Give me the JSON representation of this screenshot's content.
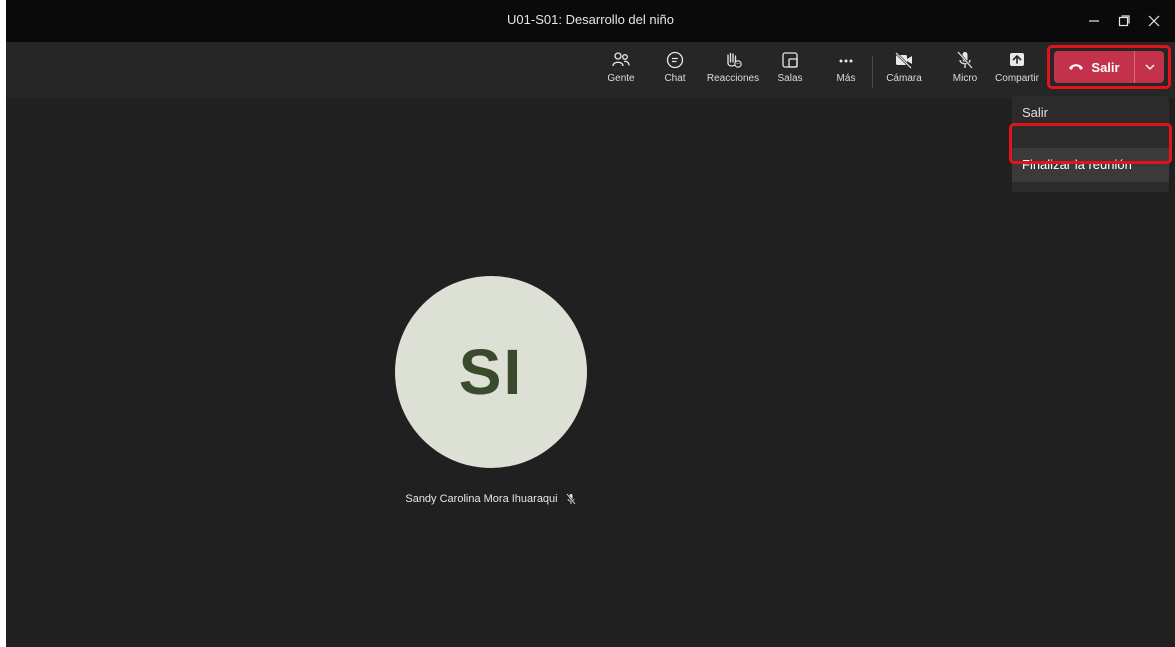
{
  "window": {
    "title": "U01-S01: Desarrollo del niño"
  },
  "toolbar": {
    "buttons": [
      {
        "id": "people",
        "label": "Gente",
        "icon": "people-icon"
      },
      {
        "id": "chat",
        "label": "Chat",
        "icon": "chat-icon"
      },
      {
        "id": "reactions",
        "label": "Reacciones",
        "icon": "reaction-hand-icon"
      },
      {
        "id": "rooms",
        "label": "Salas",
        "icon": "breakout-rooms-icon"
      },
      {
        "id": "more",
        "label": "Más",
        "icon": "more-dots-icon"
      },
      {
        "id": "camera",
        "label": "Cámara",
        "icon": "camera-off-icon"
      },
      {
        "id": "mic",
        "label": "Micro",
        "icon": "mic-off-icon"
      },
      {
        "id": "share",
        "label": "Compartir",
        "icon": "share-tray-icon"
      }
    ],
    "leave_label": "Salir"
  },
  "leave_menu": {
    "items": [
      "Salir",
      "Finalizar la reunión"
    ]
  },
  "participant": {
    "initials": "SI",
    "name": "Sandy Carolina Mora Ihuaraqui",
    "muted": true
  },
  "colors": {
    "leave_red": "#c4314b",
    "highlight_red": "#e1141c",
    "avatar_bg": "#dce0d5",
    "avatar_text": "#3a4a2c"
  }
}
